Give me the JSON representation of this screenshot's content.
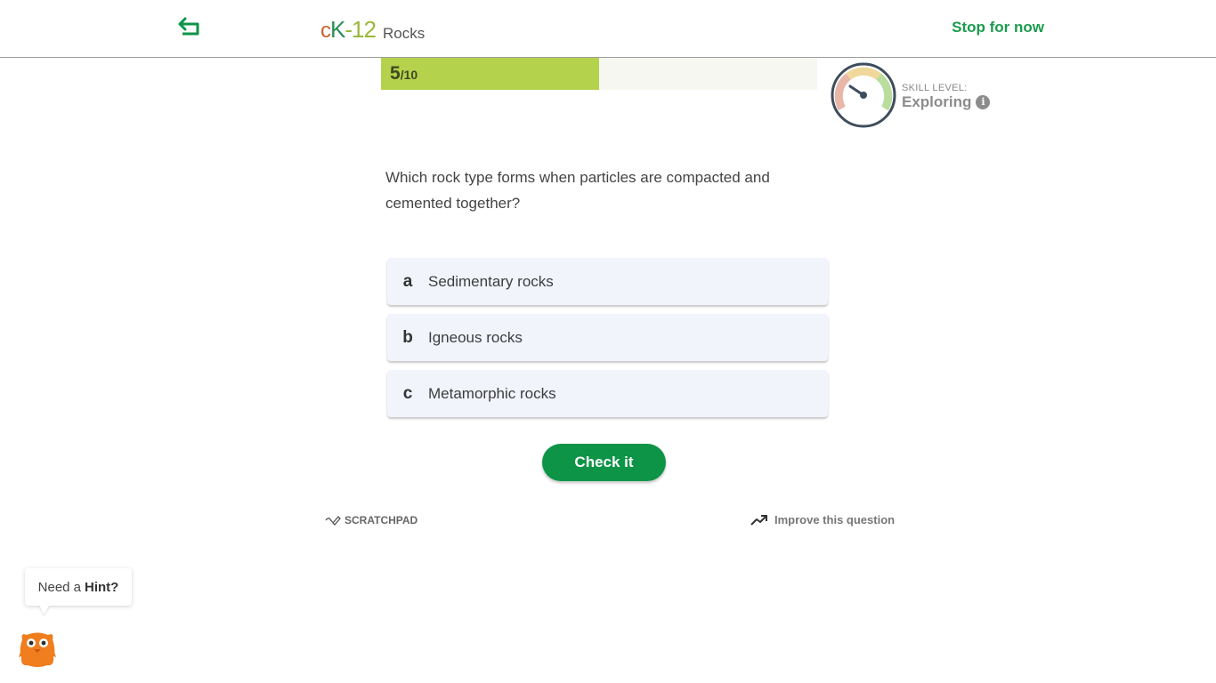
{
  "header": {
    "logo": {
      "c": "c",
      "k": "K",
      "dash": "-",
      "num": "12"
    },
    "title": "Rocks",
    "stop_label": "Stop for now"
  },
  "progress": {
    "current": "5",
    "total": "/10",
    "fraction": 0.5
  },
  "skill": {
    "caption": "SKILL LEVEL:",
    "value": "Exploring",
    "info_glyph": "i"
  },
  "question": {
    "text": "Which rock type forms when particles are compacted and cemented together?",
    "options": [
      {
        "letter": "a",
        "text": "Sedimentary rocks"
      },
      {
        "letter": "b",
        "text": "Igneous rocks"
      },
      {
        "letter": "c",
        "text": "Metamorphic rocks"
      }
    ]
  },
  "actions": {
    "check_label": "Check it",
    "scratchpad_label": "SCRATCHPAD",
    "improve_label": "Improve this question"
  },
  "hint": {
    "prefix": "Need a",
    "bold": "Hint?"
  },
  "colors": {
    "accent_green": "#0d9447",
    "progress_fill": "#b5d24c",
    "stop_green": "#1a9c4e"
  },
  "icons": {
    "back": "back-arrow-icon",
    "gauge": "gauge-icon",
    "info": "info-icon",
    "scratchpad": "pencil-icon",
    "improve": "trend-up-icon",
    "mascot": "mascot-icon"
  }
}
